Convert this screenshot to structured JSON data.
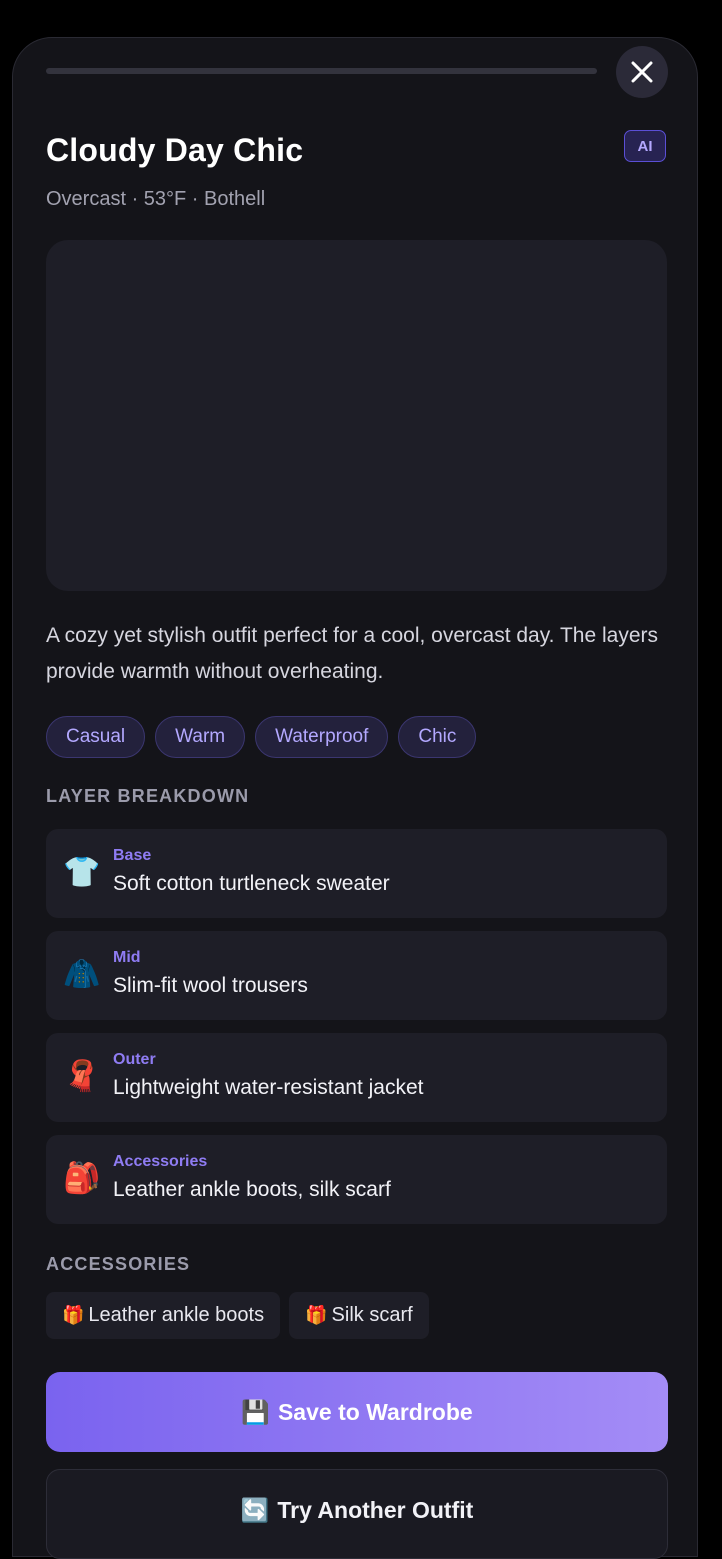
{
  "sheet": {
    "title": "Cloudy Day Chic",
    "badge": "AI",
    "subtitle": "Overcast · 53°F · Bothell",
    "description": "A cozy yet stylish outfit perfect for a cool, overcast day. The layers provide warmth without overheating."
  },
  "tags": [
    "Casual",
    "Warm",
    "Waterproof",
    "Chic"
  ],
  "layer_breakdown": {
    "heading": "LAYER BREAKDOWN",
    "items": [
      {
        "name": "Base",
        "icon": "shirt-icon",
        "emoji": "👕",
        "description": "Soft cotton turtleneck sweater"
      },
      {
        "name": "Mid",
        "icon": "coat-icon",
        "emoji": "🧥",
        "description": "Slim-fit wool trousers"
      },
      {
        "name": "Outer",
        "icon": "scarf-icon",
        "emoji": "🧣",
        "description": "Lightweight water-resistant jacket"
      },
      {
        "name": "Accessories",
        "icon": "backpack-icon",
        "emoji": "🎒",
        "description": "Leather ankle boots, silk scarf"
      }
    ]
  },
  "accessories": {
    "heading": "ACCESSORIES",
    "gift_emoji": "🎁",
    "items": [
      "Leather ankle boots",
      "Silk scarf"
    ]
  },
  "actions": {
    "save_emoji": "💾",
    "save_label": "Save to Wardrobe",
    "try_emoji": "🔄",
    "try_label": "Try Another Outfit"
  },
  "colors": {
    "background": "#141419",
    "card": "#1e1e27",
    "accent": "#8f7cf3",
    "button_gradient_start": "#7a63ef",
    "button_gradient_end": "#a48cf6"
  }
}
